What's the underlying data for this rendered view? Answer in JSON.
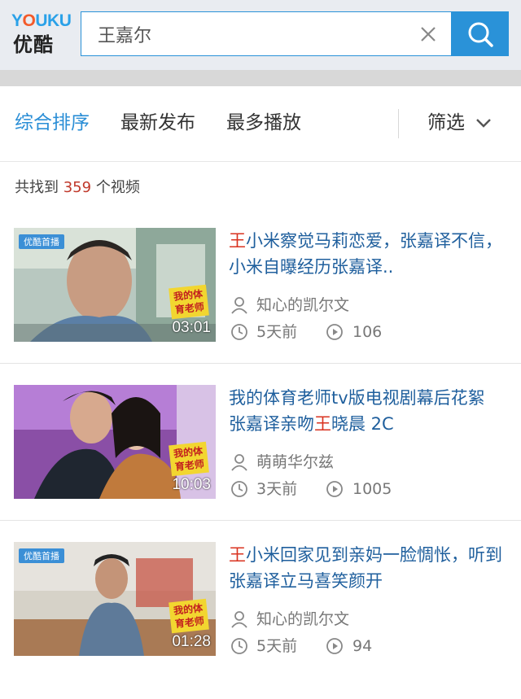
{
  "header": {
    "logo_en": "YOUKU",
    "logo_cn": "优酷",
    "search_value": "王嘉尔",
    "clear_icon": "close-icon",
    "search_icon": "search-icon",
    "accent_color": "#2a92d8"
  },
  "sort_tabs": {
    "items": [
      {
        "label": "综合排序",
        "active": true
      },
      {
        "label": "最新发布",
        "active": false
      },
      {
        "label": "最多播放",
        "active": false
      }
    ],
    "filter_label": "筛选",
    "filter_icon": "chevron-down-icon"
  },
  "results": {
    "prefix": "共找到 ",
    "count": "359",
    "suffix": " 个视频"
  },
  "videos": [
    {
      "title_highlight": "王",
      "title_rest": "小米察觉马莉恋爱，张嘉译不信，小米自曝经历张嘉译..",
      "title_full": "王小米察觉马莉恋爱，张嘉译不信，小米自曝经历张嘉译..",
      "author": "知心的凯尔文",
      "time": "5天前",
      "plays": "106",
      "duration": "03:01",
      "thumb_tag": "优酷首播",
      "show_tag": "我的体育老师"
    },
    {
      "title_before": "我的体育老师tv版电视剧幕后花絮 张嘉译亲吻",
      "title_highlight": "王",
      "title_after": "晓晨 2C",
      "author": "萌萌华尔兹",
      "time": "3天前",
      "plays": "1005",
      "duration": "10:03",
      "show_tag": "我的体育老师"
    },
    {
      "title_highlight": "王",
      "title_rest": "小米回家见到亲妈一脸惆怅，听到张嘉译立马喜笑颜开",
      "author": "知心的凯尔文",
      "time": "5天前",
      "plays": "94",
      "duration": "01:28",
      "thumb_tag": "优酷首播",
      "show_tag": "我的体育老师"
    }
  ],
  "icons": {
    "author": "user-icon",
    "time": "clock-icon",
    "plays": "play-icon"
  }
}
